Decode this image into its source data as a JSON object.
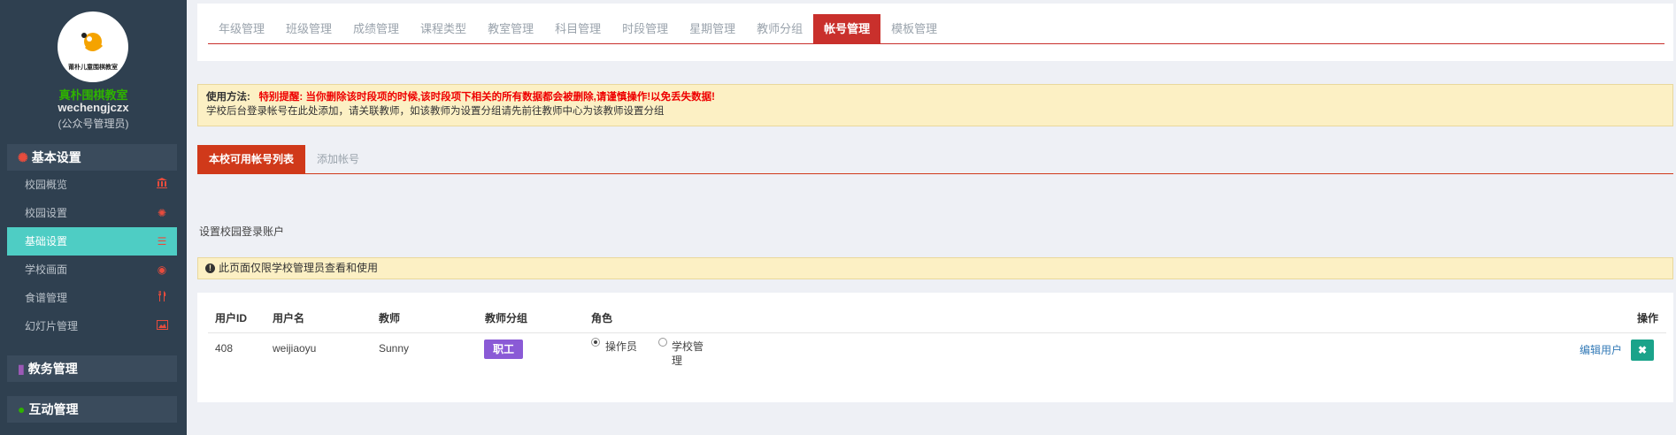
{
  "sidebar": {
    "logo_text": "莆朴儿童围棋教室",
    "school_name": "真朴围棋教室",
    "username": "wechengjczx",
    "role": "(公众号管理员)",
    "groups": [
      {
        "label": "基本设置",
        "icon": "gear-icon",
        "items": [
          {
            "label": "校园概览",
            "icon": "bank-icon"
          },
          {
            "label": "校园设置",
            "icon": "gear-icon"
          },
          {
            "label": "基础设置",
            "icon": "list-icon",
            "active": true
          },
          {
            "label": "学校画面",
            "icon": "eye-icon"
          },
          {
            "label": "食谱管理",
            "icon": "cutlery-icon"
          },
          {
            "label": "幻灯片管理",
            "icon": "image-icon"
          }
        ]
      },
      {
        "label": "教务管理",
        "icon": "book-icon"
      },
      {
        "label": "互动管理",
        "icon": "chat-icon"
      }
    ]
  },
  "top_tabs": [
    {
      "label": "年级管理"
    },
    {
      "label": "班级管理"
    },
    {
      "label": "成绩管理"
    },
    {
      "label": "课程类型"
    },
    {
      "label": "教室管理"
    },
    {
      "label": "科目管理"
    },
    {
      "label": "时段管理"
    },
    {
      "label": "星期管理"
    },
    {
      "label": "教师分组"
    },
    {
      "label": "帐号管理",
      "active": true
    },
    {
      "label": "模板管理"
    }
  ],
  "notice": {
    "label": "使用方法:",
    "warning": "特别提醒: 当你删除该时段项的时候,该时段项下相关的所有数据都会被删除,请谨慎操作!以免丢失数据!",
    "text": "学校后台登录帐号在此处添加，请关联教师，如该教师为设置分组请先前往教师中心为该教师设置分组"
  },
  "sub_tabs": [
    {
      "label": "本校可用帐号列表",
      "active": true
    },
    {
      "label": "添加帐号"
    }
  ],
  "section_title": "设置校园登录账户",
  "info": "此页面仅限学校管理员查看和使用",
  "table": {
    "headers": {
      "user_id": "用户ID",
      "username": "用户名",
      "teacher": "教师",
      "group": "教师分组",
      "role": "角色",
      "action": "操作"
    },
    "rows": [
      {
        "user_id": "408",
        "username": "weijiaoyu",
        "teacher": "Sunny",
        "group": "职工",
        "role_options": [
          "操作员",
          "学校管理"
        ],
        "role_selected": "操作员",
        "edit": "编辑用户",
        "delete_icon": "close-icon"
      }
    ]
  },
  "colors": {
    "sidebar_bg": "#2f4050",
    "active_nav": "#4ecdc4",
    "accent_red": "#c9302c",
    "badge_purple": "#8a5ad6",
    "delete_green": "#1aa38a"
  }
}
